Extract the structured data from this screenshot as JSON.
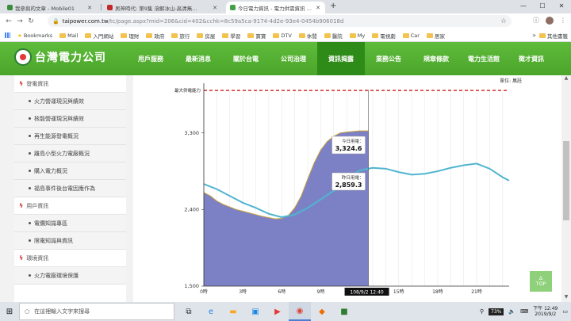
{
  "browser": {
    "tabs": [
      {
        "label": "我參與的文章 - Mobile01",
        "color": "#3b8d3b"
      },
      {
        "label": "男神時代: 第9集 溶解冰山-高清無...",
        "color": "#c62828"
      },
      {
        "label": "今日電力資訊 - 電力供需資訊 - 2...",
        "color": "#43a047",
        "active": true
      }
    ],
    "url_host": "taipower.com.tw",
    "url_path": "/tc/page.aspx?mid=206&cid=402&cchk=8c59a5ca-9174-4d2e-93e4-0454b906018d",
    "bookmarks": [
      "Bookmarks",
      "Mail",
      "入門網站",
      "理財",
      "政府",
      "旅行",
      "房屋",
      "學習",
      "寶寶",
      "DTV",
      "休閒",
      "醫院",
      "My",
      "電視劇",
      "Car",
      "居家"
    ],
    "bookmark_other": "其他書籤"
  },
  "site": {
    "logo_text": "台灣電力公司",
    "nav": [
      "用戶服務",
      "最新消息",
      "關於台電",
      "公司治理",
      "資訊揭露",
      "業務公告",
      "規章條款",
      "電力生活館",
      "徵才資訊"
    ],
    "active_nav": "資訊揭露"
  },
  "sidebar": {
    "items": [
      {
        "type": "section",
        "label": "發電資訊"
      },
      {
        "type": "item",
        "label": "火力營運現況與績效"
      },
      {
        "type": "item",
        "label": "核能營運現況與績效"
      },
      {
        "type": "item",
        "label": "再生能源發電概況"
      },
      {
        "type": "item",
        "label": "離島小型火力電廠概況"
      },
      {
        "type": "item",
        "label": "購入電力概況"
      },
      {
        "type": "item",
        "label": "福島事件後台電因應作為"
      },
      {
        "type": "section",
        "label": "用戶資訊"
      },
      {
        "type": "item",
        "label": "電價知識專區"
      },
      {
        "type": "item",
        "label": "限電知識與資訊"
      },
      {
        "type": "section",
        "label": "環境資訊"
      },
      {
        "type": "item",
        "label": "火力電廠環境保護"
      }
    ]
  },
  "chart": {
    "unit_label": "單位: 萬瓩",
    "max_supply_label": "最大供電能力",
    "today_label": "今日用電：",
    "today_value": "3,324.6",
    "yesterday_label": "昨日用電：",
    "yesterday_value": "2,859.3",
    "cursor_label": "108/9/2 12:40"
  },
  "chart_data": {
    "type": "area",
    "xlabel": "",
    "ylabel": "",
    "x_ticks": [
      "0時",
      "3時",
      "6時",
      "9時",
      "15時",
      "18時",
      "21時"
    ],
    "x_tick_hours": [
      0,
      3,
      6,
      9,
      15,
      18,
      21
    ],
    "y_ticks": [
      "1,500",
      "2,400",
      "3,300"
    ],
    "y_tick_values": [
      1500,
      2400,
      3300
    ],
    "ylim": [
      1500,
      3810
    ],
    "xlim": [
      0,
      23.5
    ],
    "max_supply_level": 3800,
    "series": [
      {
        "name": "今日用電",
        "color": "#6e73c0",
        "x": [
          0,
          0.5,
          1,
          1.5,
          2,
          2.5,
          3,
          3.5,
          4,
          4.5,
          5,
          5.5,
          6,
          6.5,
          7,
          7.5,
          8,
          8.5,
          9,
          9.5,
          10,
          10.5,
          11,
          11.5,
          12,
          12.5,
          12.67
        ],
        "y": [
          2600,
          2560,
          2500,
          2460,
          2430,
          2400,
          2380,
          2360,
          2340,
          2320,
          2305,
          2290,
          2295,
          2330,
          2420,
          2560,
          2760,
          2950,
          3100,
          3200,
          3260,
          3300,
          3310,
          3318,
          3324,
          3324,
          3324.6
        ]
      },
      {
        "name": "昨日用電",
        "color": "#4fb5d0",
        "x": [
          0,
          1,
          2,
          3,
          4,
          5,
          6,
          7,
          8,
          9,
          10,
          11,
          12,
          13,
          14,
          15,
          16,
          17,
          18,
          19,
          20,
          21,
          22,
          23,
          23.5
        ],
        "y": [
          2700,
          2640,
          2560,
          2480,
          2420,
          2350,
          2310,
          2340,
          2420,
          2520,
          2620,
          2760,
          2860,
          2890,
          2880,
          2840,
          2810,
          2820,
          2850,
          2890,
          2920,
          2940,
          2880,
          2780,
          2740
        ]
      }
    ],
    "grid": true,
    "legend": "none"
  },
  "misc": {
    "top_button": "TOP",
    "search_placeholder": "在這裡輸入文字來搜尋",
    "battery": "73%",
    "time": "下午 12:49",
    "date": "2019/9/2"
  }
}
